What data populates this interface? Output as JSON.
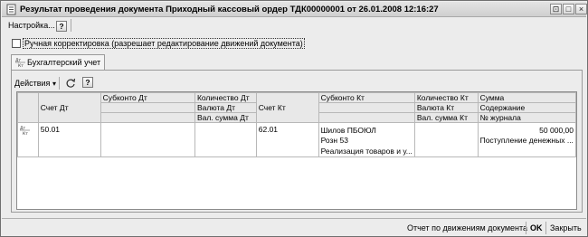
{
  "window": {
    "title": "Результат проведения документа Приходный кассовый ордер ТДК00000001 от 26.01.2008 12:16:27",
    "btn_pin": "⊡",
    "btn_restore": "□",
    "btn_close": "×"
  },
  "cmdbar": {
    "settings_label": "Настройка...",
    "help_label": "?"
  },
  "manual_correction": {
    "label": "Ручная корректировка (разрешает редактирование движений документа)",
    "checked": false
  },
  "tabs": [
    {
      "label": "Бухгалтерский учет",
      "icon": "dt-kt-icon"
    }
  ],
  "table_toolbar": {
    "actions_label": "Действия",
    "actions_arrow": "▾",
    "help_label": "?"
  },
  "grid": {
    "headers": {
      "row1": [
        "",
        "Счет Дт",
        "Субконто Дт",
        "Количество Дт",
        "Счет Кт",
        "Субконто Кт",
        "Количество Кт",
        "Сумма"
      ],
      "row2": [
        "Валюта Дт",
        "Валюта Кт",
        "Содержание"
      ],
      "row3": [
        "Вал. сумма Дт",
        "Вал. сумма Кт",
        "№ журнала"
      ]
    },
    "rows": [
      {
        "icon": "dt-kt-icon",
        "account_dt": "50.01",
        "subconto_dt": "",
        "qty_dt": "",
        "account_kt": "62.01",
        "subconto_kt": [
          "Шилов ПБОЮЛ",
          "Розн 53",
          "Реализация товаров и у..."
        ],
        "qty_kt": "",
        "sum": "50 000,00",
        "content": "Поступление денежных ..."
      }
    ]
  },
  "statusbar": {
    "report_label": "Отчет по движениям документа",
    "ok_label": "OK",
    "close_label": "Закрыть"
  }
}
